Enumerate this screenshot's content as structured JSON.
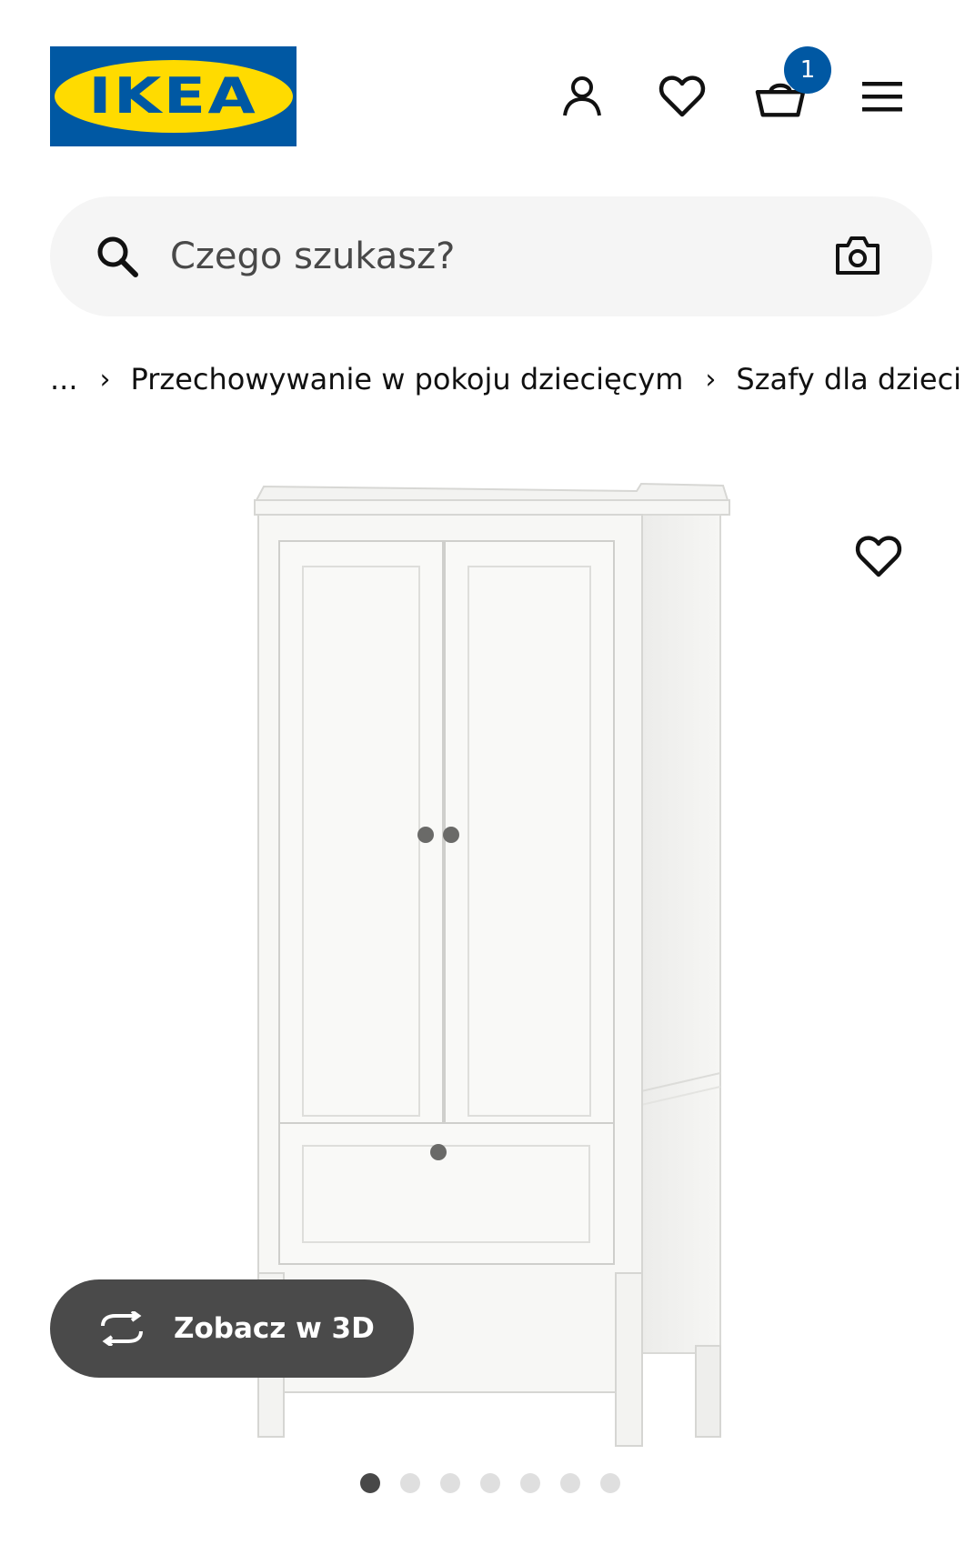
{
  "header": {
    "logo_text": "IKEA",
    "logo_reg": "®",
    "cart_badge": "1",
    "colors": {
      "brand_blue": "#0058a3",
      "brand_yellow": "#ffdb00"
    },
    "icons": [
      "user-icon",
      "heart-icon",
      "basket-icon",
      "menu-icon"
    ]
  },
  "search": {
    "placeholder": "Czego szukasz?",
    "icons": [
      "search-icon",
      "camera-icon"
    ]
  },
  "breadcrumb": {
    "ellipsis": "...",
    "items": [
      "Przechowywanie w pokoju dziecięcym",
      "Szafy dla dzieci"
    ],
    "separator": "›"
  },
  "product": {
    "view_3d_label": "Zobacz w 3D",
    "carousel": {
      "total": 7,
      "active_index": 1
    }
  }
}
